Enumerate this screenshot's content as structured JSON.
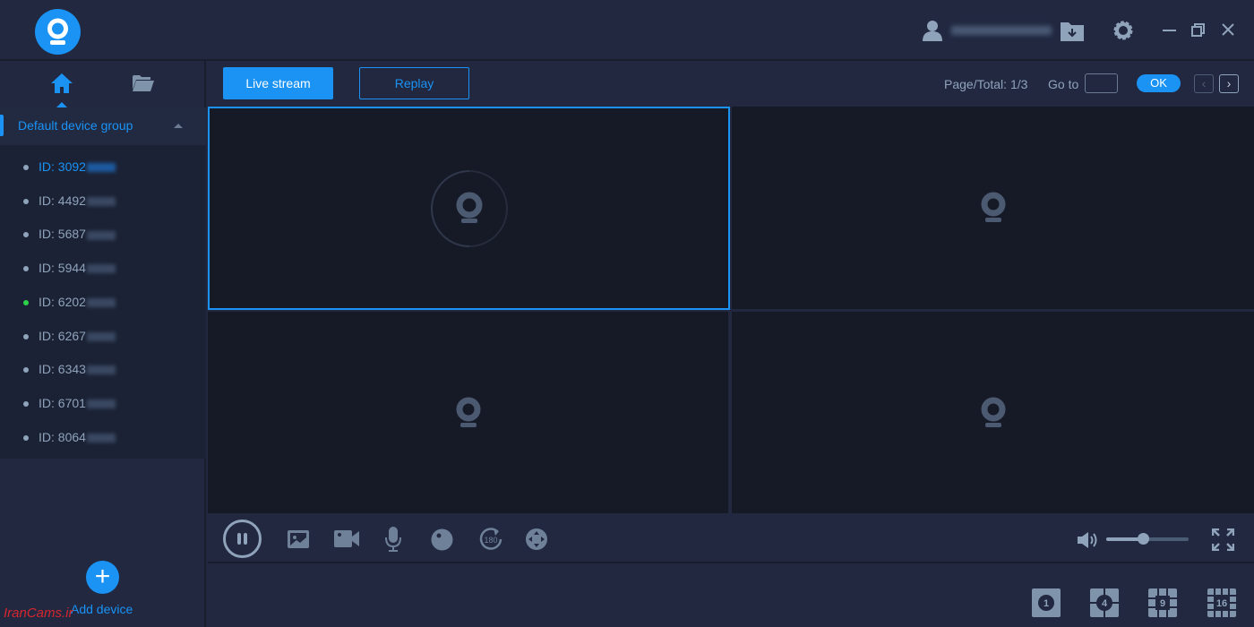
{
  "header": {
    "user_email_blurred": "",
    "icons": [
      "logo-camera-icon",
      "user-icon",
      "download-folder-icon",
      "gear-icon",
      "minimize-icon",
      "restore-icon",
      "close-icon"
    ]
  },
  "sidebar": {
    "tabs": [
      {
        "icon": "home-icon",
        "active": true
      },
      {
        "icon": "folder-icon",
        "active": false
      }
    ],
    "group": {
      "label": "Default device group",
      "expanded": true
    },
    "devices": [
      {
        "label": "ID: 3092",
        "active": true,
        "online": false
      },
      {
        "label": "ID: 4492",
        "active": false,
        "online": false
      },
      {
        "label": "ID: 5687",
        "active": false,
        "online": false
      },
      {
        "label": "ID: 5944",
        "active": false,
        "online": false
      },
      {
        "label": "ID: 6202",
        "active": false,
        "online": true
      },
      {
        "label": "ID: 6267",
        "active": false,
        "online": false
      },
      {
        "label": "ID: 6343",
        "active": false,
        "online": false
      },
      {
        "label": "ID: 6701",
        "active": false,
        "online": false
      },
      {
        "label": "ID: 8064",
        "active": false,
        "online": false
      }
    ],
    "add_device_label": "Add device"
  },
  "toolbar": {
    "live_label": "Live stream",
    "replay_label": "Replay",
    "page_total": "Page/Total: 1/3",
    "goto_label": "Go to",
    "goto_value": "",
    "ok_label": "OK"
  },
  "controls": {
    "volume_percent": 45
  },
  "layouts": [
    "1",
    "4",
    "9",
    "16"
  ],
  "watermark": "IranCams.ir",
  "colors": {
    "accent": "#1a93f5",
    "background": "#212840",
    "video_bg": "#161a27",
    "online": "#2ed34a"
  }
}
